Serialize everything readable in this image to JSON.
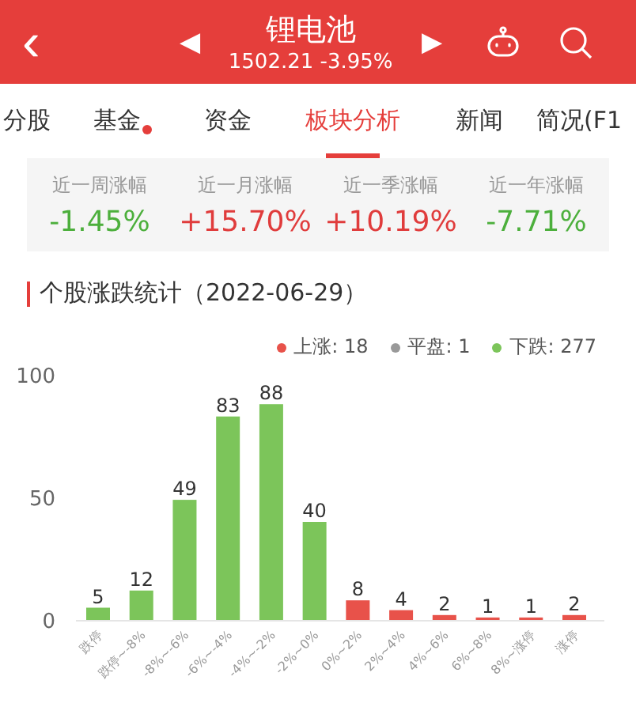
{
  "header": {
    "back": "‹",
    "prev": "◀",
    "title": "锂电池",
    "subtitle": "1502.21 -3.95%",
    "next": "▶"
  },
  "tabs": [
    {
      "label": "分股",
      "selected": false,
      "dot": false
    },
    {
      "label": "基金",
      "selected": false,
      "dot": true
    },
    {
      "label": "资金",
      "selected": false,
      "dot": false
    },
    {
      "label": "板块分析",
      "selected": true,
      "dot": false
    },
    {
      "label": "新闻",
      "selected": false,
      "dot": false
    },
    {
      "label": "简况(F1",
      "selected": false,
      "dot": false
    }
  ],
  "stats": [
    {
      "label": "近一周涨幅",
      "value": "-1.45%",
      "color": "#4caf3c"
    },
    {
      "label": "近一月涨幅",
      "value": "+15.70%",
      "color": "#e03c3c"
    },
    {
      "label": "近一季涨幅",
      "value": "+10.19%",
      "color": "#e03c3c"
    },
    {
      "label": "近一年涨幅",
      "value": "-7.71%",
      "color": "#4caf3c"
    }
  ],
  "section_title": "个股涨跌统计（2022-06-29）",
  "legend": [
    {
      "label": "上涨: 18",
      "color": "#e8524a"
    },
    {
      "label": "平盘: 1",
      "color": "#999999"
    },
    {
      "label": "下跌: 277",
      "color": "#7cc55a"
    }
  ],
  "chart_data": {
    "type": "bar",
    "categories": [
      "跌停",
      "跌停~-8%",
      "-8%~-6%",
      "-6%~-4%",
      "-4%~-2%",
      "-2%~0%",
      "0%~2%",
      "2%~4%",
      "4%~6%",
      "6%~8%",
      "8%~涨停",
      "涨停"
    ],
    "series": [
      {
        "color": "#7cc55a",
        "values": [
          5,
          12,
          49,
          83,
          88,
          40,
          null,
          null,
          null,
          null,
          null,
          null
        ]
      },
      {
        "color": "#e8524a",
        "values": [
          null,
          null,
          null,
          null,
          null,
          null,
          8,
          4,
          2,
          1,
          1,
          2
        ]
      }
    ],
    "ylim": [
      0,
      100
    ],
    "yticks": [
      0,
      50,
      100
    ],
    "data_labels": true
  }
}
